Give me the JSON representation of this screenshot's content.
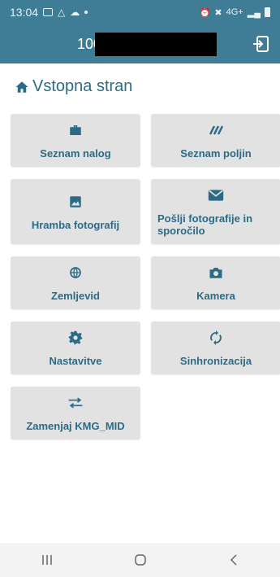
{
  "status_bar": {
    "time": "13:04",
    "network": "4G+"
  },
  "app_bar": {
    "title": "100",
    "logout_icon": "logout-icon"
  },
  "page": {
    "heading": "Vstopna stran",
    "heading_icon": "home-icon"
  },
  "tiles": [
    {
      "label": "Seznam nalog",
      "icon": "briefcase-icon"
    },
    {
      "label": "Seznam poljin",
      "icon": "field-lines-icon"
    },
    {
      "label": "Hramba fotografij",
      "icon": "image-icon"
    },
    {
      "label": "Pošlji fotografije in sporočilo",
      "icon": "mail-icon"
    },
    {
      "label": "Zemljevid",
      "icon": "globe-icon"
    },
    {
      "label": "Kamera",
      "icon": "camera-icon"
    },
    {
      "label": "Nastavitve",
      "icon": "gear-icon"
    },
    {
      "label": "Sinhronizacija",
      "icon": "sync-icon"
    },
    {
      "label": "Zamenjaj KMG_MID",
      "icon": "swap-icon"
    }
  ],
  "colors": {
    "primary": "#3f7c95",
    "accent_text": "#2c6b86",
    "tile_bg": "#e2e2e2"
  }
}
